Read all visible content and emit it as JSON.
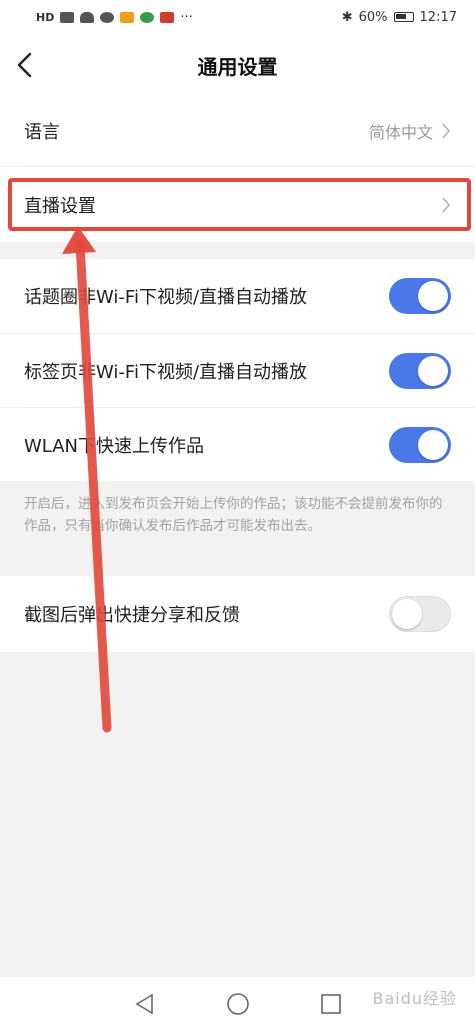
{
  "status_bar": {
    "left_label": "HD",
    "battery": "60%",
    "time": "12:17",
    "icons": [
      "signal-icon",
      "wifi-icon",
      "notification-icon",
      "video-app-icon",
      "app-icon",
      "app-icon",
      "more-icon",
      "bluetooth-icon",
      "battery-icon"
    ]
  },
  "header": {
    "title": "通用设置",
    "back_icon": "chevron-left-icon"
  },
  "settings": {
    "language": {
      "label": "语言",
      "value": "简体中文"
    },
    "live": {
      "label": "直播设置"
    },
    "toggles": [
      {
        "label": "话题圈非Wi-Fi下视频/直播自动播放",
        "on": true
      },
      {
        "label": "标签页非Wi-Fi下视频/直播自动播放",
        "on": true
      },
      {
        "label": "WLAN下快速上传作品",
        "on": true
      }
    ],
    "note": "开启后，进入到发布页会开始上传你的作品；该功能不会提前发布你的作品，只有当你确认发布后作品才可能发布出去。",
    "screenshot_share": {
      "label": "截图后弹出快捷分享和反馈",
      "on": false
    }
  },
  "watermark": "Baidu经验",
  "colors": {
    "accent": "#4a78e8",
    "highlight": "#e2483a",
    "background": "#f2f2f2"
  }
}
